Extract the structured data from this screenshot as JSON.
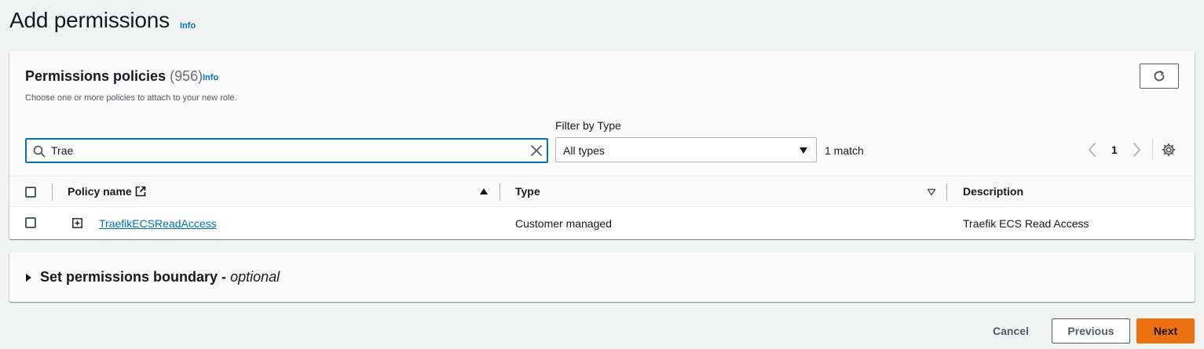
{
  "page": {
    "title": "Add permissions",
    "info_label": "Info"
  },
  "policies": {
    "title": "Permissions policies",
    "count": "(956)",
    "info_label": "Info",
    "description": "Choose one or more policies to attach to your new role.",
    "search": {
      "value": "Trae",
      "placeholder": ""
    },
    "filter": {
      "label": "Filter by Type",
      "selected": "All types"
    },
    "match_count": "1 match",
    "pager": {
      "current_page": "1"
    },
    "columns": [
      {
        "label": "Policy name"
      },
      {
        "label": "Type"
      },
      {
        "label": "Description"
      }
    ],
    "rows": [
      {
        "name": "TraefikECSReadAccess",
        "type": "Customer managed",
        "description": "Traefik ECS Read Access"
      }
    ]
  },
  "boundary": {
    "title": "Set permissions boundary -",
    "optional": "optional"
  },
  "footer": {
    "cancel_label": "Cancel",
    "previous_label": "Previous",
    "next_label": "Next"
  },
  "colors": {
    "accent": "#0073bb",
    "primary_button": "#ec7211",
    "background": "#f2f3f3"
  },
  "icons": [
    "search-icon",
    "clear-icon",
    "caret-down-icon",
    "chevron-left-icon",
    "chevron-right-icon",
    "gear-icon",
    "refresh-icon",
    "external-link-icon",
    "expand-icon",
    "caret-right-icon"
  ]
}
